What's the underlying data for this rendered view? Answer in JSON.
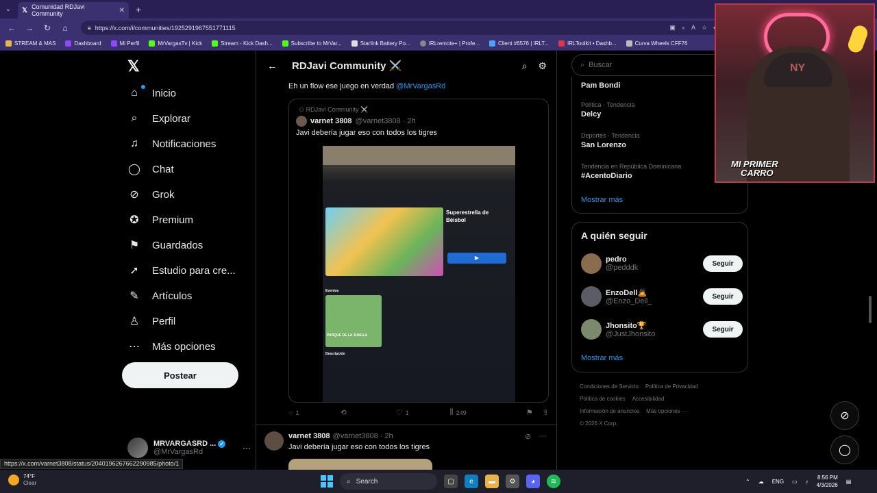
{
  "browser": {
    "tab_title": "Comunidad RDJavi Community",
    "url": "https://x.com/i/communities/1925291967551771115",
    "bookmarks": [
      "STREAM & MAS",
      "Dashboard",
      "Mi Perfil",
      "MrVargasTv | Kick",
      "Stream - Kick Dash...",
      "Subscribe to MrVar...",
      "Starlink Battery Po...",
      "IRLremote+ | Profe...",
      "Client #6576 | IRLT...",
      "IRLToolkit • Dashb...",
      "Curva Wheels CFF76"
    ]
  },
  "nav": {
    "items": [
      "Inicio",
      "Explorar",
      "Notificaciones",
      "Chat",
      "Grok",
      "Premium",
      "Guardados",
      "Estudio para cre...",
      "Artículos",
      "Perfil",
      "Más opciones"
    ],
    "icons": [
      "home-icon",
      "search-icon",
      "bell-icon",
      "chat-icon",
      "grok-icon",
      "premium-icon",
      "bookmark-icon",
      "rocket-icon",
      "article-icon",
      "person-icon",
      "more-icon"
    ],
    "post_label": "Postear",
    "account_name": "MRVARGASRD ...",
    "account_handle": "@MrVargasRd"
  },
  "header": {
    "title": "RDJavi Community ⚔️"
  },
  "tweet": {
    "text": "Eh un flow ese juego en verdad",
    "mention": "@MrVargasRd",
    "quote": {
      "community": "RDJavi Community ⚔️",
      "name": "varnet 3808",
      "handle": "@varnet3808 · 2h",
      "text": "Javi debería jugar eso con todos los tigres",
      "photo_title": "Superestrella de Béisbol",
      "photo_card_label": "PARQUE DE LA JUNGLA",
      "photo_section": "Eventos",
      "photo_desc_label": "Descripción"
    },
    "replies": "1",
    "likes": "1",
    "views": "249"
  },
  "tweet2": {
    "name": "varnet 3808",
    "handle": "@varnet3808 · 2h",
    "text": "Javi debería jugar eso con todos los tigres"
  },
  "sidebar": {
    "search_placeholder": "Buscar",
    "trends": [
      {
        "category": "",
        "title": "Pam Bondi"
      },
      {
        "category": "Política · Tendencia",
        "title": "Delcy"
      },
      {
        "category": "Deportes · Tendencia",
        "title": "San Lorenzo"
      },
      {
        "category": "Tendencia en República Dominicana",
        "title": "#AcentoDiario"
      }
    ],
    "show_more": "Mostrar más",
    "follow_title": "A quién seguir",
    "follow": [
      {
        "name": "pedro",
        "handle": "@pedddk"
      },
      {
        "name": "EnzoDell🙇",
        "handle": "@Enzo_Dell_"
      },
      {
        "name": "Jhonsito🏆",
        "handle": "@JustJhonsito"
      }
    ],
    "follow_button": "Seguir",
    "footer": [
      "Condiciones de Servicio",
      "Política de Privacidad",
      "Política de cookies",
      "Accesibilidad",
      "Información de anuncios",
      "Más opciones ···",
      "© 2026 X Corp."
    ]
  },
  "webcam": {
    "banner_line1": "MI PRIMER",
    "banner_line2": "CARRO"
  },
  "status_url": "https://x.com/varnet3808/status/2040196267662290985/photo/1",
  "taskbar": {
    "temp": "74°F",
    "weather": "Clear",
    "search": "Search",
    "lang": "ENG",
    "time": "8:56 PM",
    "date": "4/3/2026"
  },
  "colors": {
    "accent": "#1d9bf0",
    "browser_frame": "#3b3170"
  }
}
